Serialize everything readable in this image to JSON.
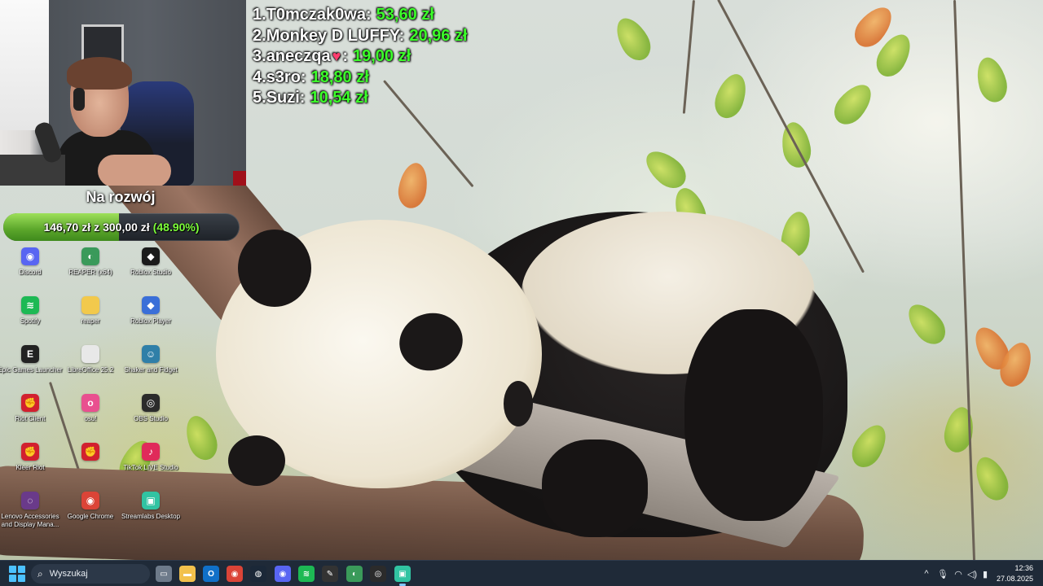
{
  "leaderboard": [
    {
      "rank": "1.",
      "name": "T0mczak0wa:",
      "amount": "53,60 zł",
      "heart": false
    },
    {
      "rank": "2.",
      "name": "Monkey D LUFFY:",
      "amount": "20,96 zł",
      "heart": false
    },
    {
      "rank": "3.",
      "name": "aneczqa",
      "amount": "19,00 zł",
      "heart": true,
      "suffix": ":"
    },
    {
      "rank": "4.",
      "name": "s3ro:",
      "amount": "18,80 zł",
      "heart": false
    },
    {
      "rank": "5.",
      "name": "Suzi:",
      "amount": "10,54 zł",
      "heart": false
    }
  ],
  "goal": {
    "title": "Na rozwój",
    "current": "146,70 zł",
    "separator": "z",
    "target": "300,00 zł",
    "percent_label": "(48.90%)",
    "fraction": 0.489
  },
  "desktop_icons": [
    {
      "label": "Discord",
      "icon": "discord-icon",
      "color": "#5865f2",
      "glyph": "◉"
    },
    {
      "label": "REAPER (x64)",
      "icon": "reaper-icon",
      "color": "#3a9a5a",
      "glyph": "◐"
    },
    {
      "label": "Roblox Studio",
      "icon": "roblox-studio-icon",
      "color": "#1b1b1b",
      "glyph": "◆"
    },
    {
      "label": "Spotify",
      "icon": "spotify-icon",
      "color": "#1db954",
      "glyph": "≋"
    },
    {
      "label": "reaper",
      "icon": "folder-icon",
      "color": "#f2c94c",
      "glyph": ""
    },
    {
      "label": "Roblox Player",
      "icon": "roblox-player-icon",
      "color": "#3a6fd8",
      "glyph": "◆"
    },
    {
      "label": "Epic Games Launcher",
      "icon": "epic-games-icon",
      "color": "#222222",
      "glyph": "E"
    },
    {
      "label": "LibreOffice 25.2",
      "icon": "libreoffice-icon",
      "color": "#e8e8e8",
      "glyph": ""
    },
    {
      "label": "Shaker and Fidget",
      "icon": "shaker-fidget-icon",
      "color": "#2f7fa8",
      "glyph": "☺"
    },
    {
      "label": "Riot Client",
      "icon": "riot-client-icon",
      "color": "#d2202f",
      "glyph": "✊"
    },
    {
      "label": "osu!",
      "icon": "osu-icon",
      "color": "#e9508f",
      "glyph": "o"
    },
    {
      "label": "OBS Studio",
      "icon": "obs-icon",
      "color": "#2b2b2b",
      "glyph": "◎"
    },
    {
      "label": "Kleer Riot",
      "icon": "riot-client-icon",
      "color": "#d2202f",
      "glyph": "✊"
    },
    {
      "label": "",
      "icon": "riot-client-icon",
      "color": "#d2202f",
      "glyph": "✊"
    },
    {
      "label": "TikTok LIVE Studio",
      "icon": "tiktok-icon",
      "color": "#e02a5a",
      "glyph": "♪"
    },
    {
      "label": "Lenovo Accessories and Display Mana...",
      "icon": "lenovo-icon",
      "color": "#6a3a8a",
      "glyph": "◌"
    },
    {
      "label": "Google Chrome",
      "icon": "chrome-icon",
      "color": "#db4437",
      "glyph": "◉"
    },
    {
      "label": "Streamlabs Desktop",
      "icon": "streamlabs-icon",
      "color": "#31c3a2",
      "glyph": "▣"
    }
  ],
  "taskbar": {
    "search_placeholder": "Wyszukaj",
    "apps": [
      {
        "name": "task-view-icon",
        "color": "#6d7a8a",
        "glyph": "▭"
      },
      {
        "name": "file-explorer-icon",
        "color": "#f2c14c",
        "glyph": "▬"
      },
      {
        "name": "outlook-icon",
        "color": "#1070c8",
        "glyph": "O"
      },
      {
        "name": "chrome-icon",
        "color": "#db4437",
        "glyph": "◉"
      },
      {
        "name": "steam-icon",
        "color": "#1b2838",
        "glyph": "◍"
      },
      {
        "name": "discord-icon",
        "color": "#5865f2",
        "glyph": "◉"
      },
      {
        "name": "spotify-icon",
        "color": "#1db954",
        "glyph": "≋"
      },
      {
        "name": "epic-games-icon",
        "color": "#333333",
        "glyph": "✎"
      },
      {
        "name": "reaper-icon",
        "color": "#3a9a5a",
        "glyph": "◐"
      },
      {
        "name": "obs-icon",
        "color": "#2b2b2b",
        "glyph": "◎"
      },
      {
        "name": "streamlabs-icon",
        "color": "#31c3a2",
        "glyph": "▣"
      }
    ],
    "tray": {
      "chevron": "^",
      "mic": "🎙",
      "wifi": "◠",
      "volume": "◁)",
      "battery": "▮"
    },
    "time": "12:36",
    "date": "27.08.2025"
  }
}
